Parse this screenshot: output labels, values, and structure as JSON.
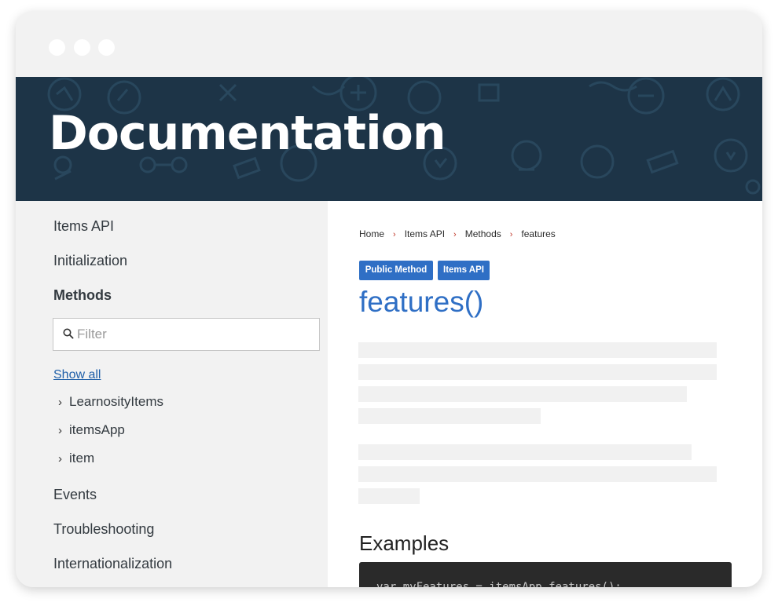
{
  "hero": {
    "title": "Documentation"
  },
  "sidebar": {
    "items": [
      {
        "label": "Items API"
      },
      {
        "label": "Initialization"
      },
      {
        "label": "Methods"
      }
    ],
    "filter": {
      "placeholder": "Filter",
      "value": ""
    },
    "show_all": "Show all",
    "tree": [
      {
        "label": "LearnosityItems",
        "icon": "chevron-right-icon"
      },
      {
        "label": "itemsApp",
        "icon": "chevron-right-icon"
      },
      {
        "label": "item",
        "icon": "chevron-right-icon"
      }
    ],
    "items_after": [
      {
        "label": "Events"
      },
      {
        "label": "Troubleshooting"
      },
      {
        "label": "Internationalization"
      }
    ]
  },
  "content": {
    "breadcrumb": [
      "Home",
      "Items API",
      "Methods",
      "features"
    ],
    "badges": [
      "Public Method",
      "Items API"
    ],
    "title": "features()",
    "examples_heading": "Examples",
    "code": "var myFeatures = itemsApp.features();"
  },
  "colors": {
    "hero_bg": "#1d3447",
    "accent_blue": "#2f6fc5",
    "link_blue": "#1f5fa8",
    "breadcrumb_separator": "#c0392b",
    "code_bg": "#2a2a2a"
  }
}
